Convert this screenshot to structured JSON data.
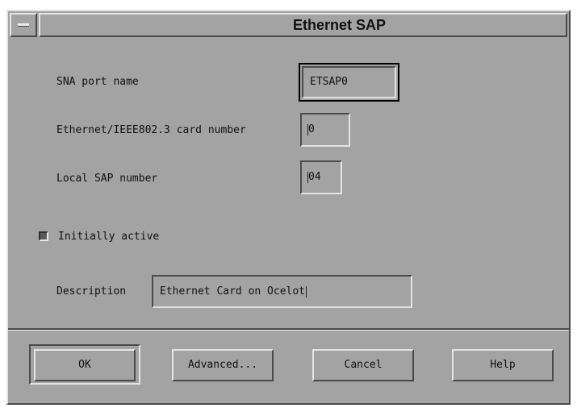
{
  "window": {
    "title": "Ethernet SAP"
  },
  "form": {
    "sna_port_name": {
      "label": "SNA port name",
      "value": "ETSAP0"
    },
    "card_number": {
      "label": "Ethernet/IEEE802.3 card number",
      "value": "0"
    },
    "local_sap": {
      "label": "Local SAP number",
      "value": "04"
    },
    "initially_active": {
      "label": "Initially active",
      "checked": true
    },
    "description": {
      "label": "Description",
      "value": "Ethernet Card on Ocelot"
    }
  },
  "buttons": {
    "ok": "OK",
    "advanced": "Advanced...",
    "cancel": "Cancel",
    "help": "Help"
  }
}
